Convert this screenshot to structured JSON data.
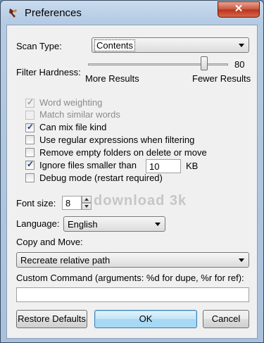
{
  "window": {
    "title": "Preferences",
    "close_label": "✕"
  },
  "scan_type": {
    "label": "Scan Type:",
    "value": "Contents"
  },
  "filter": {
    "label": "Filter Hardness:",
    "value": "80",
    "more_label": "More Results",
    "fewer_label": "Fewer Results",
    "level": 80
  },
  "options": [
    {
      "label": "Word weighting",
      "checked": true,
      "enabled": false
    },
    {
      "label": "Match similar words",
      "checked": false,
      "enabled": false
    },
    {
      "label": "Can mix file kind",
      "checked": true,
      "enabled": true
    },
    {
      "label": "Use regular expressions when filtering",
      "checked": false,
      "enabled": true
    },
    {
      "label": "Remove empty folders on delete or move",
      "checked": false,
      "enabled": true
    },
    {
      "label": "Ignore files smaller than",
      "checked": true,
      "enabled": true
    },
    {
      "label": "Debug mode (restart required)",
      "checked": false,
      "enabled": true
    }
  ],
  "ignore_size": {
    "value": "10",
    "unit": "KB"
  },
  "font_size": {
    "label": "Font size:",
    "value": "8"
  },
  "language": {
    "label": "Language:",
    "value": "English"
  },
  "copy_move": {
    "label": "Copy and Move:",
    "value": "Recreate relative path"
  },
  "custom_command": {
    "label": "Custom Command (arguments: %d for dupe, %r for ref):",
    "value": ""
  },
  "buttons": {
    "restore": "Restore Defaults",
    "ok": "OK",
    "cancel": "Cancel"
  },
  "watermark": "download 3k"
}
